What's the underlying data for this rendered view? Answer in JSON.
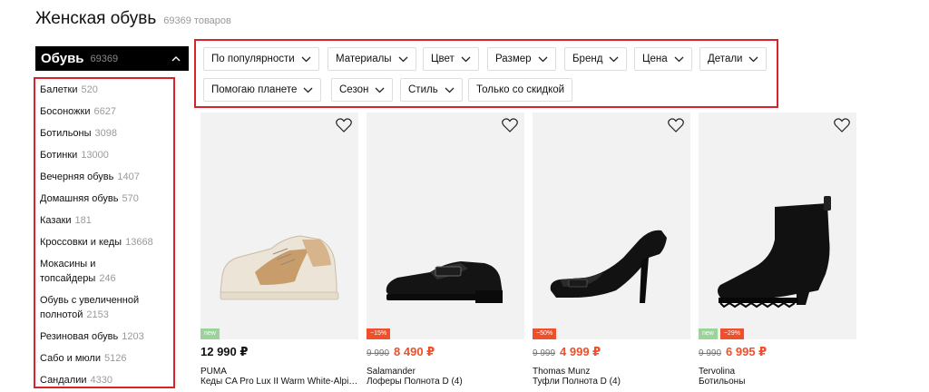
{
  "header": {
    "title": "Женская обувь",
    "count": "69369 товаров"
  },
  "category": {
    "title": "Обувь",
    "count": "69369"
  },
  "subcategories": [
    {
      "label": "Балетки",
      "count": "520"
    },
    {
      "label": "Босоножки",
      "count": "6627"
    },
    {
      "label": "Ботильоны",
      "count": "3098"
    },
    {
      "label": "Ботинки",
      "count": "13000"
    },
    {
      "label": "Вечерняя обувь",
      "count": "1407"
    },
    {
      "label": "Домашняя обувь",
      "count": "570"
    },
    {
      "label": "Казаки",
      "count": "181"
    },
    {
      "label": "Кроссовки и кеды",
      "count": "13668"
    },
    {
      "label": "Мокасины и топсайдеры",
      "count": "246"
    },
    {
      "label": "Обувь с увеличенной полнотой",
      "count": "2153"
    },
    {
      "label": "Резиновая обувь",
      "count": "1203"
    },
    {
      "label": "Сабо и мюли",
      "count": "5126"
    },
    {
      "label": "Сандалии",
      "count": "4330"
    }
  ],
  "filters": [
    {
      "label": "По популярности"
    },
    {
      "label": "Материалы"
    },
    {
      "label": "Цвет"
    },
    {
      "label": "Размер"
    },
    {
      "label": "Бренд"
    },
    {
      "label": "Цена"
    },
    {
      "label": "Детали"
    },
    {
      "label": "Помогаю планете"
    },
    {
      "label": "Сезон"
    },
    {
      "label": "Стиль"
    },
    {
      "label": "Только со скидкой"
    }
  ],
  "products": [
    {
      "brand": "PUMA",
      "name": "Кеды CA Pro Lux II Warm White-Alpine Snow-Dark Sand",
      "price": "12 990 ₽",
      "old_price": "",
      "badges": [
        "new"
      ],
      "image": "sneaker"
    },
    {
      "brand": "Salamander",
      "name": "Лоферы Полнота D (4)",
      "price": "8 490 ₽",
      "old_price": "9 990",
      "badges": [
        "−15%"
      ],
      "image": "loafer"
    },
    {
      "brand": "Thomas Munz",
      "name": "Туфли Полнота D (4)",
      "price": "4 999 ₽",
      "old_price": "9 999",
      "badges": [
        "−50%"
      ],
      "image": "pump"
    },
    {
      "brand": "Tervolina",
      "name": "Ботильоны",
      "price": "6 995 ₽",
      "old_price": "9 990",
      "badges": [
        "new",
        "−29%"
      ],
      "image": "bootie"
    }
  ],
  "colors": {
    "highlight": "#d8232a",
    "sale": "#f04f2c",
    "new_badge": "#9bd39b"
  }
}
